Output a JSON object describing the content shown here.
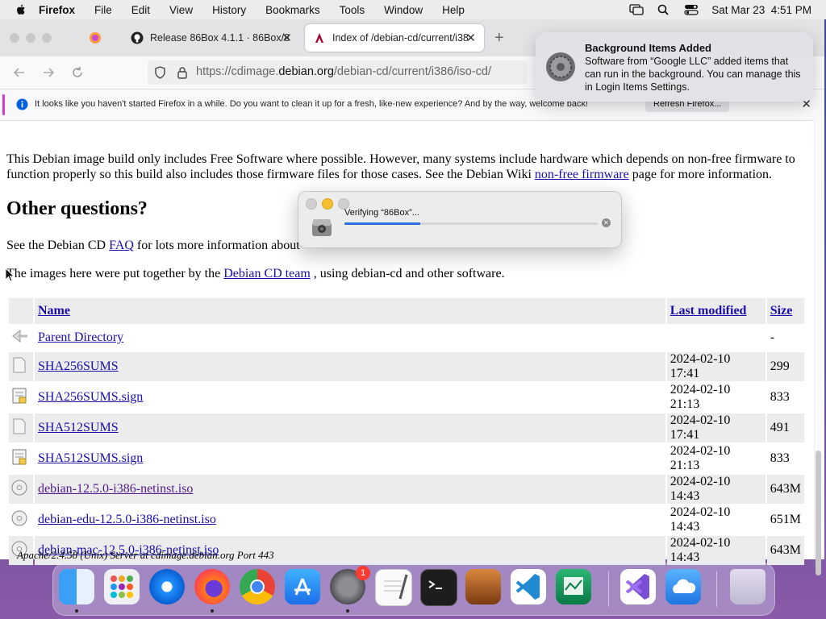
{
  "menubar": {
    "app_name": "Firefox",
    "items": [
      "File",
      "Edit",
      "View",
      "History",
      "Bookmarks",
      "Tools",
      "Window",
      "Help"
    ],
    "clock": "Sat Mar 23  4:51 PM"
  },
  "tabs": [
    {
      "title": "Release 86Box 4.1.1 · 86Box/86"
    },
    {
      "title": "Index of /debian-cd/current/i38"
    }
  ],
  "address_bar": {
    "url_prefix": "https://cdimage.",
    "url_domain": "debian.org",
    "url_path": "/debian-cd/current/i386/iso-cd/"
  },
  "infobar": {
    "message": "It looks like you haven't started Firefox in a while. Do you want to clean it up for a fresh, like-new experience? And by the way, welcome back!",
    "button": "Refresh Firefox..."
  },
  "page": {
    "para1_text": "This Debian image build only includes Free Software where possible. However, many systems include hardware which depends on non-free firmware to function properly so this build also includes those firmware files for those cases. See the Debian Wiki",
    "para1_link": "non-free firmware",
    "para1_tail": "page for more information.",
    "heading": "Other questions?",
    "para2_text": "See the Debian CD",
    "para2_link": "FAQ",
    "para2_tail": "for lots more information about",
    "para3_text": "The images here were put together by the",
    "para3_link": "Debian CD team",
    "para3_tail": ", using debian-cd and other software.",
    "table_headers": {
      "name": "Name",
      "modified": "Last modified",
      "size": "Size"
    },
    "rows": [
      {
        "name": "Parent Directory",
        "modified": "",
        "size": "-",
        "icon": "back-icon"
      },
      {
        "name": "SHA256SUMS",
        "modified": "2024-02-10 17:41",
        "size": "299",
        "icon": "text-file-icon"
      },
      {
        "name": "SHA256SUMS.sign",
        "modified": "2024-02-10 21:13",
        "size": "833",
        "icon": "signed-file-icon"
      },
      {
        "name": "SHA512SUMS",
        "modified": "2024-02-10 17:41",
        "size": "491",
        "icon": "text-file-icon"
      },
      {
        "name": "SHA512SUMS.sign",
        "modified": "2024-02-10 21:13",
        "size": "833",
        "icon": "signed-file-icon"
      },
      {
        "name": "debian-12.5.0-i386-netinst.iso",
        "modified": "2024-02-10 14:43",
        "size": "643M",
        "icon": "disc-icon"
      },
      {
        "name": "debian-edu-12.5.0-i386-netinst.iso",
        "modified": "2024-02-10 14:43",
        "size": "651M",
        "icon": "disc-icon"
      },
      {
        "name": "debian-mac-12.5.0-i386-netinst.iso",
        "modified": "2024-02-10 14:43",
        "size": "643M",
        "icon": "disc-icon"
      }
    ],
    "server_address": "Apache/2.4.58 (Unix) Server at cdimage.debian.org Port 443"
  },
  "verify_dialog": {
    "text": "Verifying “86Box”...",
    "progress": 0.3
  },
  "notification": {
    "title": "Background Items Added",
    "body": "Software from “Google LLC” added items that can run in the background. You can manage this in Login Items Settings."
  },
  "dock": {
    "settings_badge": "1",
    "apps": [
      "finder",
      "launchpad",
      "safari",
      "firefox",
      "chrome",
      "app-store",
      "system-settings",
      "textedit",
      "terminal",
      "garageband",
      "vscode",
      "activity-monitor",
      "visual-studio",
      "icloud",
      "trash"
    ]
  },
  "colors": {
    "link": "#1a0dab",
    "accent_blue": "#2a6fde",
    "infobar_accent": "#d83bd2"
  }
}
